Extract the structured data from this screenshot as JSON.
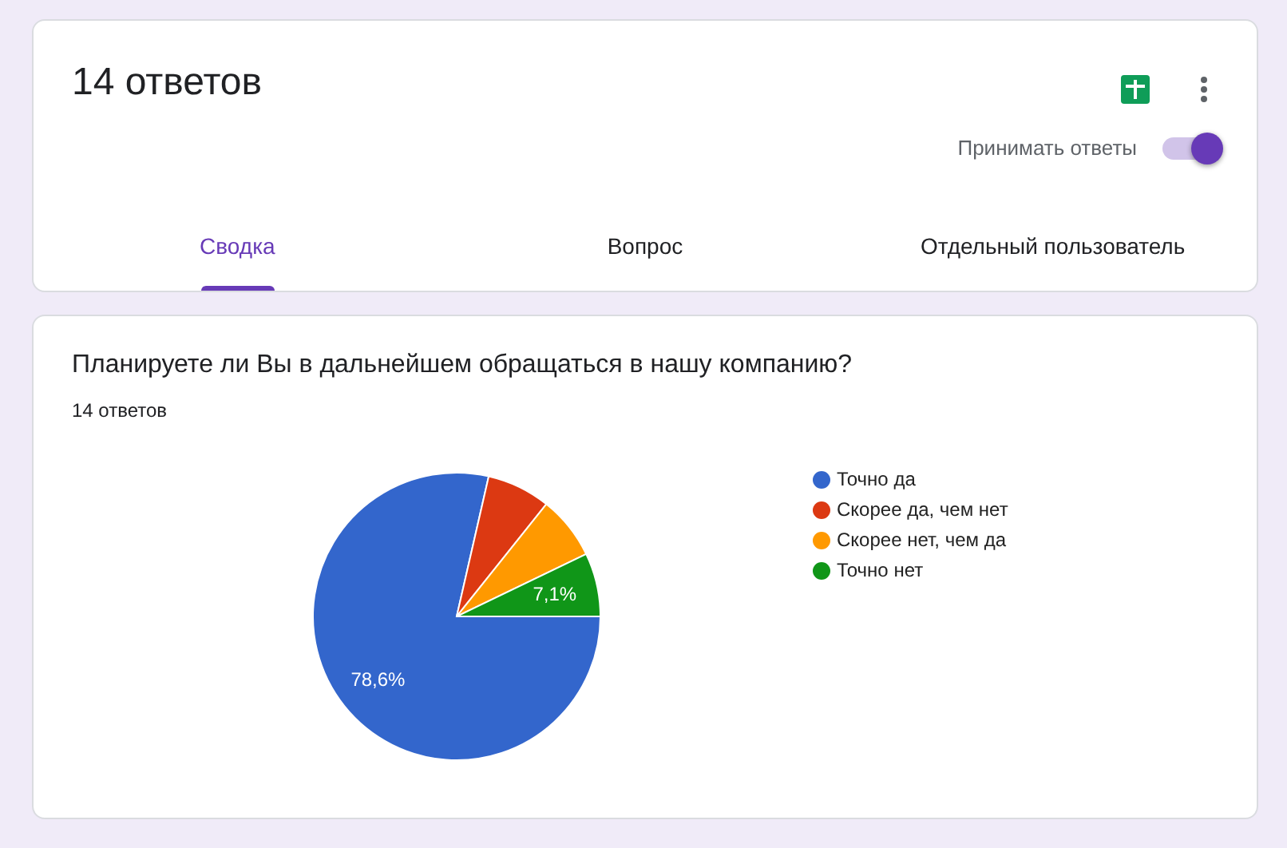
{
  "header": {
    "title": "14 ответов",
    "accepting": {
      "label": "Принимать ответы",
      "on": true
    }
  },
  "tabs": [
    {
      "label": "Сводка",
      "selected": true
    },
    {
      "label": "Вопрос",
      "selected": false
    },
    {
      "label": "Отдельный пользователь",
      "selected": false
    }
  ],
  "question": {
    "title": "Планируете ли Вы в дальнейшем обращаться в нашу компанию?",
    "count": "14 ответов",
    "chart_data": {
      "type": "pie",
      "categories": [
        "Точно да",
        "Скорее да, чем нет",
        "Скорее нет, чем да",
        "Точно нет"
      ],
      "values": [
        78.58,
        7.14,
        7.14,
        7.14
      ],
      "legend": "right",
      "colors": [
        "#3366cc",
        "#dc3912",
        "#ff9900",
        "#109618"
      ],
      "value_labels": [
        "78,6%",
        null,
        null,
        "7,1%"
      ]
    }
  }
}
